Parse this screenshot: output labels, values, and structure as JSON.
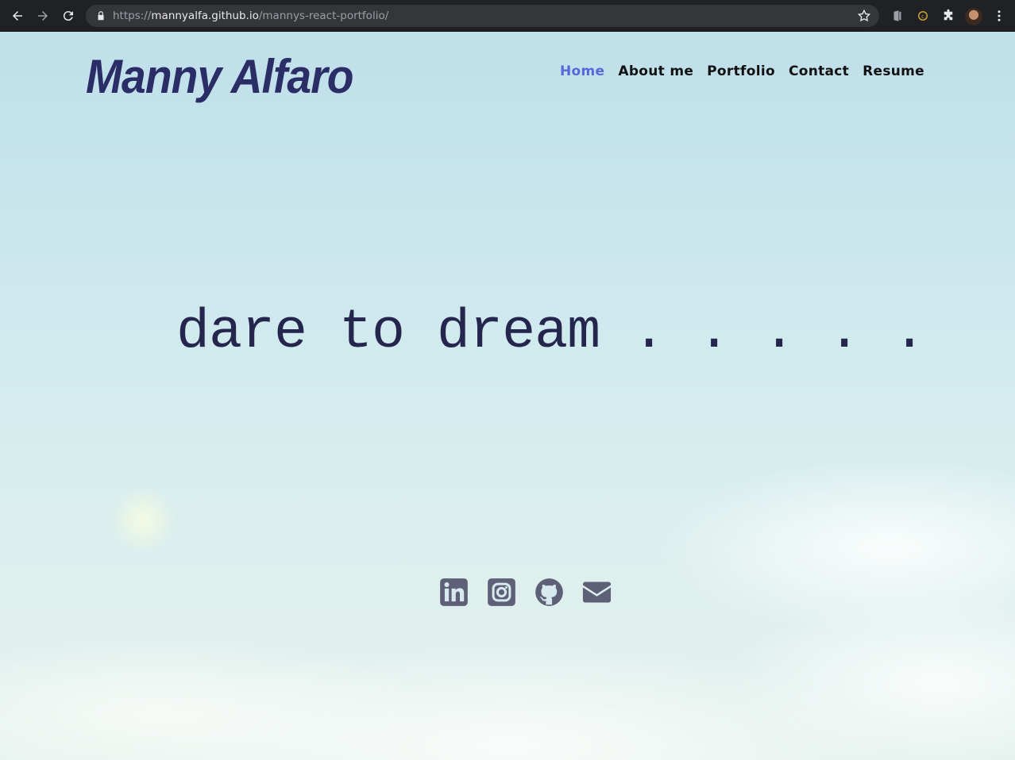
{
  "browser": {
    "url_scheme": "https://",
    "url_host": "mannyalfa.github.io",
    "url_path": "/mannys-react-portfolio/",
    "icons": [
      "back-icon",
      "forward-icon",
      "reload-icon",
      "lock-icon",
      "star-icon",
      "office-extension-icon",
      "extension-icon",
      "puzzle-icon",
      "profile-avatar",
      "menu-icon"
    ]
  },
  "header": {
    "brand": "Manny Alfaro",
    "nav": [
      {
        "label": "Home",
        "active": true
      },
      {
        "label": "About me",
        "active": false
      },
      {
        "label": "Portfolio",
        "active": false
      },
      {
        "label": "Contact",
        "active": false
      },
      {
        "label": "Resume",
        "active": false
      }
    ]
  },
  "hero": {
    "tagline": "dare to dream . . . . ."
  },
  "socials": {
    "icons": [
      "linkedin-icon",
      "instagram-icon",
      "github-icon",
      "email-icon"
    ]
  },
  "colors": {
    "brand": "#2b2d66",
    "nav_active": "#5a67d8",
    "icon": "#5e6078",
    "chrome_bg": "#202124"
  }
}
